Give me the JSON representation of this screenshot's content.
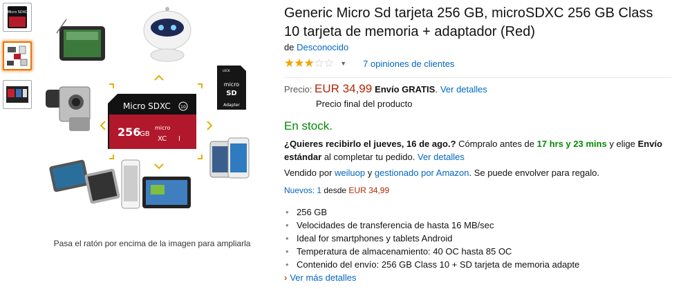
{
  "thumbnails": [
    {
      "label": "Micro SDXC"
    },
    {
      "label": ""
    },
    {
      "label": ""
    }
  ],
  "main_image": {
    "card_label": "Micro SDXC",
    "card_capacity": "256",
    "card_unit": "GB",
    "card_badge": "10",
    "card_micro": "micro",
    "card_xc": "XC",
    "card_uhs": "I",
    "adapter_top": "micro",
    "adapter_sd": "SD",
    "adapter_bottom": "Adapter",
    "adapter_lock": "LOCK"
  },
  "zoom_hint": "Pasa el ratón por encima de la imagen para ampliarla",
  "product": {
    "title": "Generic Micro Sd tarjeta 256 GB, microSDXC 256 GB Class 10 tarjeta de memoria + adaptador (Red)",
    "brand_prefix": "de",
    "brand": "Desconocido",
    "rating": 3,
    "rating_max": 5,
    "reviews": "7 opiniones de clientes"
  },
  "price": {
    "label": "Precio:",
    "amount": "EUR 34,99",
    "shipping": "Envío GRATIS",
    "shipping_sep": ".",
    "details_link": "Ver detalles",
    "final_note": "Precio final del producto"
  },
  "stock": "En stock.",
  "delivery": {
    "question": "¿Quieres recibirlo el jueves, 16 de ago.?",
    "buy_before": "Cómpralo antes de",
    "countdown": "17 hrs y 23 mins",
    "choose": "y elige",
    "shipping_option": "Envío estándar",
    "complete": "al completar tu pedido.",
    "details_link": "Ver detalles"
  },
  "seller": {
    "sold_by": "Vendido por",
    "seller_name": "weiluop",
    "and": "y",
    "fulfilled": "gestionado por Amazon",
    "gift": ". Se puede envolver para regalo."
  },
  "new_offers": {
    "link": "Nuevos: 1",
    "from": "desde",
    "price": "EUR 34,99"
  },
  "features": [
    "256 GB",
    "Velocidades de transferencia de hasta 16 MB/sec",
    "Ideal for smartphones y tablets Android",
    "Temperatura de almacenamiento: 40 OC hasta 85 OC",
    "Contenido del envío: 256 GB Class 10 + SD tarjeta de memoria adapte"
  ],
  "more_details": "Ver más detalles",
  "colors": {
    "link": "#0066c0",
    "price": "#b12704",
    "stock": "#008a00",
    "star": "#f0a400",
    "selected_border": "#e77600"
  }
}
